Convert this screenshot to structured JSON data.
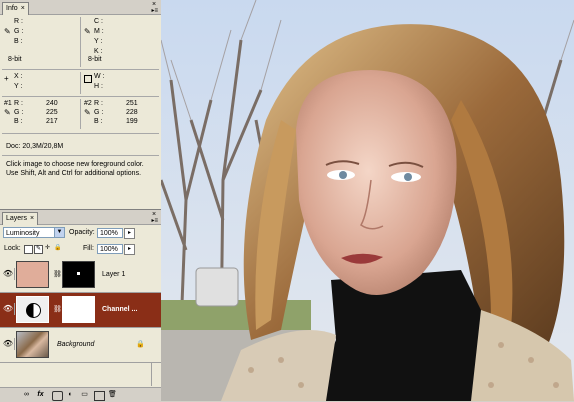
{
  "info_panel": {
    "tab_label": "Info",
    "tab_close": "×",
    "close_glyph": "×",
    "menu_glyph": "▸≡",
    "rgb": {
      "r_label": "R :",
      "g_label": "G :",
      "b_label": "B :",
      "bit": "8-bit"
    },
    "cmyk": {
      "c_label": "C :",
      "m_label": "M :",
      "y_label": "Y :",
      "k_label": "K :",
      "bit": "8-bit"
    },
    "xy": {
      "x_label": "X :",
      "y_label": "Y :"
    },
    "wh": {
      "w_label": "W :",
      "h_label": "H :"
    },
    "sample1": {
      "label": "#1",
      "r_label": "R :",
      "g_label": "G :",
      "b_label": "B :",
      "r": "240",
      "g": "225",
      "b": "217"
    },
    "sample2": {
      "label": "#2",
      "r_label": "R :",
      "g_label": "G :",
      "b_label": "B :",
      "r": "251",
      "g": "228",
      "b": "199"
    },
    "doc": "Doc: 20,3M/20,8M",
    "help": "Click image to choose new foreground color. Use Shift, Alt and Ctrl for additional options."
  },
  "layers_panel": {
    "tab_label": "Layers",
    "tab_close": "×",
    "close_glyph": "×",
    "menu_glyph": "▸≡",
    "blend_mode": "Luminosity",
    "opacity_label": "Opacity:",
    "opacity_value": "100%",
    "lock_label": "Lock:",
    "fill_label": "Fill:",
    "fill_value": "100%",
    "layers": [
      {
        "name": "Layer 1",
        "thumb_color": "#e0ad9a",
        "active": false
      },
      {
        "name": "Channel ...",
        "thumb_color": "#ffffff",
        "active": true
      },
      {
        "name": "Background",
        "thumb_color": "#9a7a5a",
        "active": false
      }
    ],
    "bottom_icons": [
      "link-icon",
      "fx-icon",
      "mask-icon",
      "adjustment-icon",
      "folder-icon",
      "new-layer-icon",
      "trash-icon"
    ]
  },
  "colors": {
    "accent_active_layer": "#8a2e17",
    "panel_bg": "#ece9d8"
  }
}
